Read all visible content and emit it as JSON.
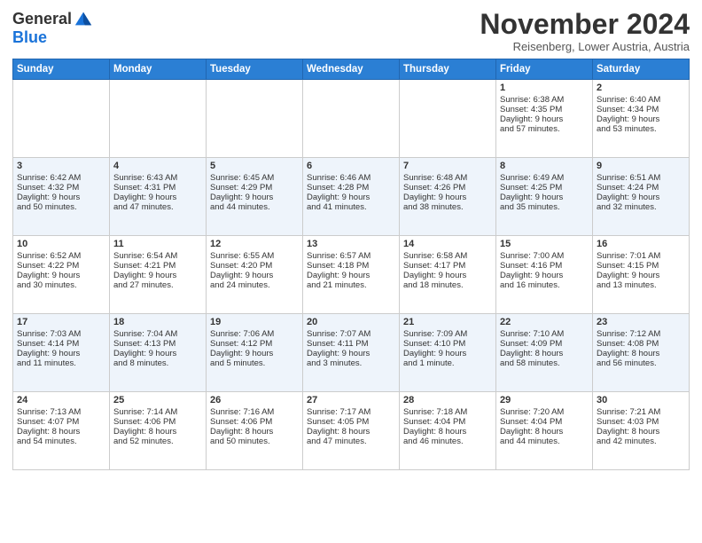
{
  "header": {
    "logo_line1": "General",
    "logo_line2": "Blue",
    "month": "November 2024",
    "location": "Reisenberg, Lower Austria, Austria"
  },
  "weekdays": [
    "Sunday",
    "Monday",
    "Tuesday",
    "Wednesday",
    "Thursday",
    "Friday",
    "Saturday"
  ],
  "weeks": [
    [
      {
        "day": "",
        "content": ""
      },
      {
        "day": "",
        "content": ""
      },
      {
        "day": "",
        "content": ""
      },
      {
        "day": "",
        "content": ""
      },
      {
        "day": "",
        "content": ""
      },
      {
        "day": "1",
        "content": "Sunrise: 6:38 AM\nSunset: 4:35 PM\nDaylight: 9 hours\nand 57 minutes."
      },
      {
        "day": "2",
        "content": "Sunrise: 6:40 AM\nSunset: 4:34 PM\nDaylight: 9 hours\nand 53 minutes."
      }
    ],
    [
      {
        "day": "3",
        "content": "Sunrise: 6:42 AM\nSunset: 4:32 PM\nDaylight: 9 hours\nand 50 minutes."
      },
      {
        "day": "4",
        "content": "Sunrise: 6:43 AM\nSunset: 4:31 PM\nDaylight: 9 hours\nand 47 minutes."
      },
      {
        "day": "5",
        "content": "Sunrise: 6:45 AM\nSunset: 4:29 PM\nDaylight: 9 hours\nand 44 minutes."
      },
      {
        "day": "6",
        "content": "Sunrise: 6:46 AM\nSunset: 4:28 PM\nDaylight: 9 hours\nand 41 minutes."
      },
      {
        "day": "7",
        "content": "Sunrise: 6:48 AM\nSunset: 4:26 PM\nDaylight: 9 hours\nand 38 minutes."
      },
      {
        "day": "8",
        "content": "Sunrise: 6:49 AM\nSunset: 4:25 PM\nDaylight: 9 hours\nand 35 minutes."
      },
      {
        "day": "9",
        "content": "Sunrise: 6:51 AM\nSunset: 4:24 PM\nDaylight: 9 hours\nand 32 minutes."
      }
    ],
    [
      {
        "day": "10",
        "content": "Sunrise: 6:52 AM\nSunset: 4:22 PM\nDaylight: 9 hours\nand 30 minutes."
      },
      {
        "day": "11",
        "content": "Sunrise: 6:54 AM\nSunset: 4:21 PM\nDaylight: 9 hours\nand 27 minutes."
      },
      {
        "day": "12",
        "content": "Sunrise: 6:55 AM\nSunset: 4:20 PM\nDaylight: 9 hours\nand 24 minutes."
      },
      {
        "day": "13",
        "content": "Sunrise: 6:57 AM\nSunset: 4:18 PM\nDaylight: 9 hours\nand 21 minutes."
      },
      {
        "day": "14",
        "content": "Sunrise: 6:58 AM\nSunset: 4:17 PM\nDaylight: 9 hours\nand 18 minutes."
      },
      {
        "day": "15",
        "content": "Sunrise: 7:00 AM\nSunset: 4:16 PM\nDaylight: 9 hours\nand 16 minutes."
      },
      {
        "day": "16",
        "content": "Sunrise: 7:01 AM\nSunset: 4:15 PM\nDaylight: 9 hours\nand 13 minutes."
      }
    ],
    [
      {
        "day": "17",
        "content": "Sunrise: 7:03 AM\nSunset: 4:14 PM\nDaylight: 9 hours\nand 11 minutes."
      },
      {
        "day": "18",
        "content": "Sunrise: 7:04 AM\nSunset: 4:13 PM\nDaylight: 9 hours\nand 8 minutes."
      },
      {
        "day": "19",
        "content": "Sunrise: 7:06 AM\nSunset: 4:12 PM\nDaylight: 9 hours\nand 5 minutes."
      },
      {
        "day": "20",
        "content": "Sunrise: 7:07 AM\nSunset: 4:11 PM\nDaylight: 9 hours\nand 3 minutes."
      },
      {
        "day": "21",
        "content": "Sunrise: 7:09 AM\nSunset: 4:10 PM\nDaylight: 9 hours\nand 1 minute."
      },
      {
        "day": "22",
        "content": "Sunrise: 7:10 AM\nSunset: 4:09 PM\nDaylight: 8 hours\nand 58 minutes."
      },
      {
        "day": "23",
        "content": "Sunrise: 7:12 AM\nSunset: 4:08 PM\nDaylight: 8 hours\nand 56 minutes."
      }
    ],
    [
      {
        "day": "24",
        "content": "Sunrise: 7:13 AM\nSunset: 4:07 PM\nDaylight: 8 hours\nand 54 minutes."
      },
      {
        "day": "25",
        "content": "Sunrise: 7:14 AM\nSunset: 4:06 PM\nDaylight: 8 hours\nand 52 minutes."
      },
      {
        "day": "26",
        "content": "Sunrise: 7:16 AM\nSunset: 4:06 PM\nDaylight: 8 hours\nand 50 minutes."
      },
      {
        "day": "27",
        "content": "Sunrise: 7:17 AM\nSunset: 4:05 PM\nDaylight: 8 hours\nand 47 minutes."
      },
      {
        "day": "28",
        "content": "Sunrise: 7:18 AM\nSunset: 4:04 PM\nDaylight: 8 hours\nand 46 minutes."
      },
      {
        "day": "29",
        "content": "Sunrise: 7:20 AM\nSunset: 4:04 PM\nDaylight: 8 hours\nand 44 minutes."
      },
      {
        "day": "30",
        "content": "Sunrise: 7:21 AM\nSunset: 4:03 PM\nDaylight: 8 hours\nand 42 minutes."
      }
    ]
  ]
}
